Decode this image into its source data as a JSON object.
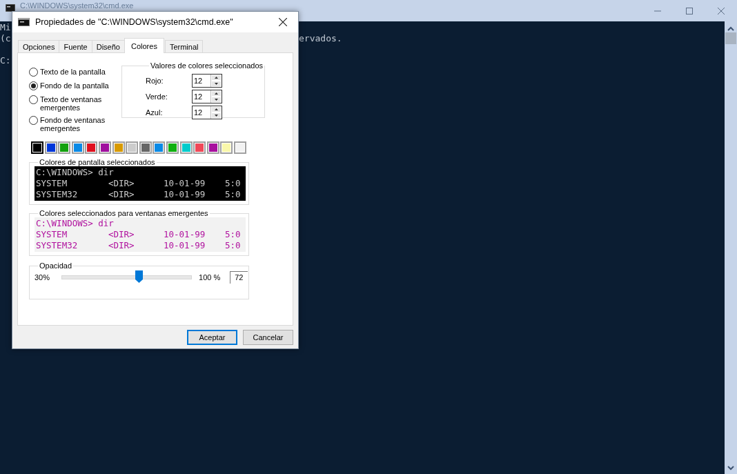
{
  "console_window": {
    "title": "C:\\WINDOWS\\system32\\cmd.exe",
    "output": [
      {
        "kind": "text",
        "left": "Mi"
      },
      {
        "kind": "text",
        "left": "(c",
        "right": "ervados."
      },
      {
        "kind": "blank"
      },
      {
        "kind": "text",
        "left": "C:"
      }
    ]
  },
  "dialog": {
    "title": "Propiedades de \"C:\\WINDOWS\\system32\\cmd.exe\"",
    "tabs": [
      {
        "label": "Opciones",
        "selected": false
      },
      {
        "label": "Fuente",
        "selected": false
      },
      {
        "label": "Diseño",
        "selected": false
      },
      {
        "label": "Colores",
        "selected": true
      },
      {
        "label": "Terminal",
        "selected": false
      }
    ],
    "color_targets": [
      {
        "label": "Texto de la pantalla",
        "selected": false
      },
      {
        "label": "Fondo de la pantalla",
        "selected": true
      },
      {
        "label": "Texto de ventanas emergentes",
        "selected": false
      },
      {
        "label": "Fondo de ventanas emergentes",
        "selected": false
      }
    ],
    "color_values": {
      "title": "Valores de colores seleccionados",
      "fields": [
        {
          "label": "Rojo:",
          "value": "12"
        },
        {
          "label": "Verde:",
          "value": "12"
        },
        {
          "label": "Azul:",
          "value": "12"
        }
      ]
    },
    "swatches": [
      {
        "color": "#000000",
        "selected": true
      },
      {
        "color": "#0037da",
        "selected": false
      },
      {
        "color": "#13a10e",
        "selected": false
      },
      {
        "color": "#0a8ae6",
        "selected": false
      },
      {
        "color": "#e0101f",
        "selected": false
      },
      {
        "color": "#a0109e",
        "selected": false
      },
      {
        "color": "#d89a00",
        "selected": false
      },
      {
        "color": "#cccccc",
        "selected": false
      },
      {
        "color": "#666666",
        "selected": false
      },
      {
        "color": "#0a8ae6",
        "selected": false
      },
      {
        "color": "#10b010",
        "selected": false
      },
      {
        "color": "#00cccc",
        "selected": false
      },
      {
        "color": "#f04858",
        "selected": false
      },
      {
        "color": "#a8109e",
        "selected": false
      },
      {
        "color": "#f9f7aa",
        "selected": false
      },
      {
        "color": "#f2f2f2",
        "selected": false
      }
    ],
    "screen_preview": {
      "title": "Colores de pantalla seleccionados",
      "lines": [
        [
          "C:\\WINDOWS> dir"
        ],
        [
          "SYSTEM",
          "<DIR>",
          "10-01-99",
          "5:0"
        ],
        [
          "SYSTEM32",
          "<DIR>",
          "10-01-99",
          "5:0"
        ]
      ]
    },
    "popup_preview": {
      "title": "Colores seleccionados para ventanas emergentes",
      "lines": [
        [
          "C:\\WINDOWS> dir"
        ],
        [
          "SYSTEM",
          "<DIR>",
          "10-01-99",
          "5:0"
        ],
        [
          "SYSTEM32",
          "<DIR>",
          "10-01-99",
          "5:0"
        ]
      ]
    },
    "opacity": {
      "title": "Opacidad",
      "min_label": "30%",
      "max_label": "100 %",
      "level": 0.6,
      "value": "72"
    },
    "buttons": [
      {
        "label": "Aceptar",
        "default": true
      },
      {
        "label": "Cancelar",
        "default": false
      }
    ]
  }
}
